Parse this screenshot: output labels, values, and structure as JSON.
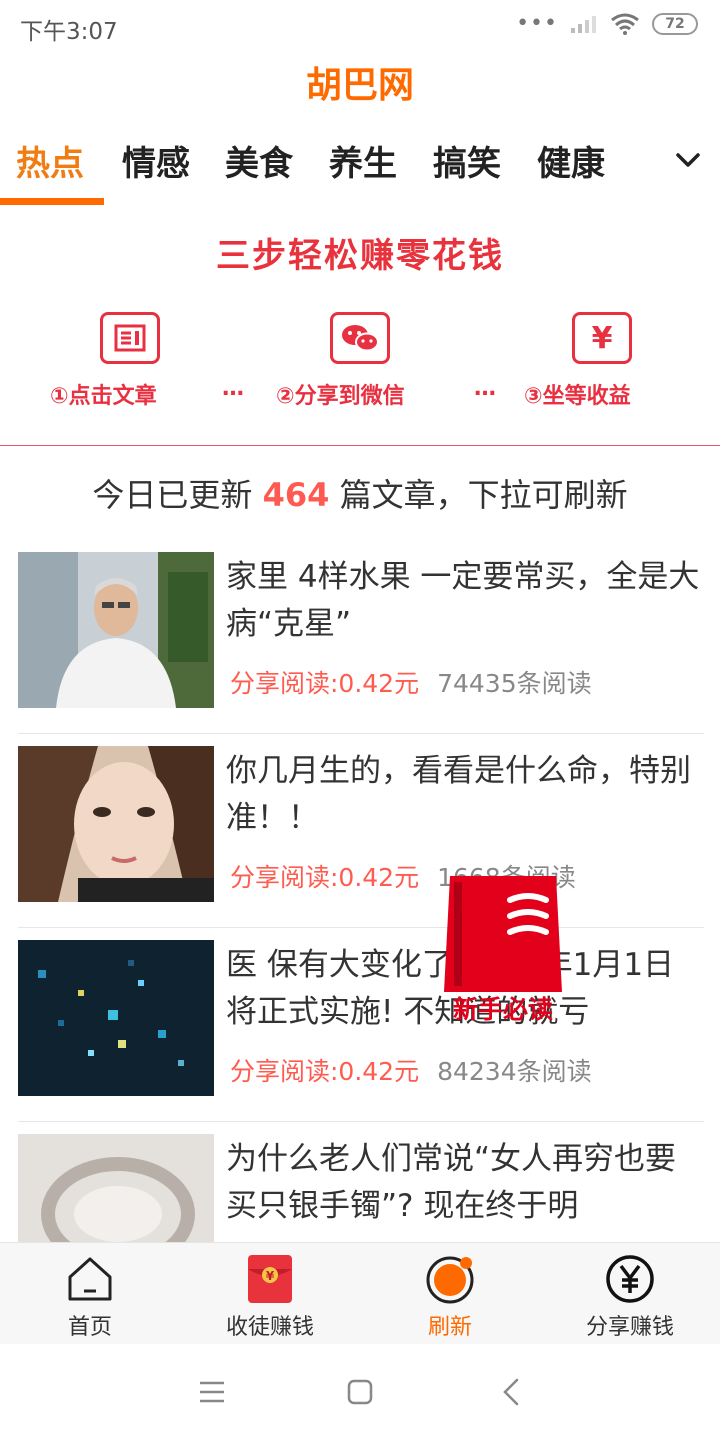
{
  "status": {
    "time": "下午3:07",
    "battery": "72"
  },
  "header": {
    "title": "胡巴网"
  },
  "tabs": [
    {
      "label": "热点",
      "active": true
    },
    {
      "label": "情感"
    },
    {
      "label": "美食"
    },
    {
      "label": "养生"
    },
    {
      "label": "搞笑"
    },
    {
      "label": "健康"
    }
  ],
  "promo": {
    "title": "三步轻松赚零花钱",
    "steps": [
      {
        "label": "①点击文章",
        "icon": "article-icon"
      },
      {
        "label": "②分享到微信",
        "icon": "wechat-icon"
      },
      {
        "label": "③坐等收益",
        "icon": "yen-icon"
      }
    ],
    "separator": "…"
  },
  "notice": {
    "prefix": "今日已更新",
    "count": "464",
    "suffix": "篇文章，下拉可刷新"
  },
  "articles": [
    {
      "title": "家里 4样水果 一定要常买，全是大病“克星”",
      "share": "分享阅读:0.42元",
      "reads": "74435条阅读"
    },
    {
      "title": "你几月生的，看看是什么命，特别准！！",
      "share": "分享阅读:0.42元",
      "reads": "1668条阅读"
    },
    {
      "title": "医 保有大变化了 2020年1月1日将正式实施! 不知道的就亏",
      "share": "分享阅读:0.42元",
      "reads": "84234条阅读"
    },
    {
      "title": "为什么老人们常说“女人再穷也要买只银手镯”? 现在终于明",
      "share": "",
      "reads": ""
    }
  ],
  "guide": {
    "label": "新手必读"
  },
  "bottom_nav": [
    {
      "label": "首页",
      "icon": "home-icon"
    },
    {
      "label": "收徒赚钱",
      "icon": "red-envelope-icon"
    },
    {
      "label": "刷新",
      "icon": "refresh-icon",
      "active": true
    },
    {
      "label": "分享赚钱",
      "icon": "yen-circle-icon"
    }
  ],
  "colors": {
    "brand": "#ff6a00",
    "promo": "#e83040",
    "price": "#ff5b4f"
  }
}
